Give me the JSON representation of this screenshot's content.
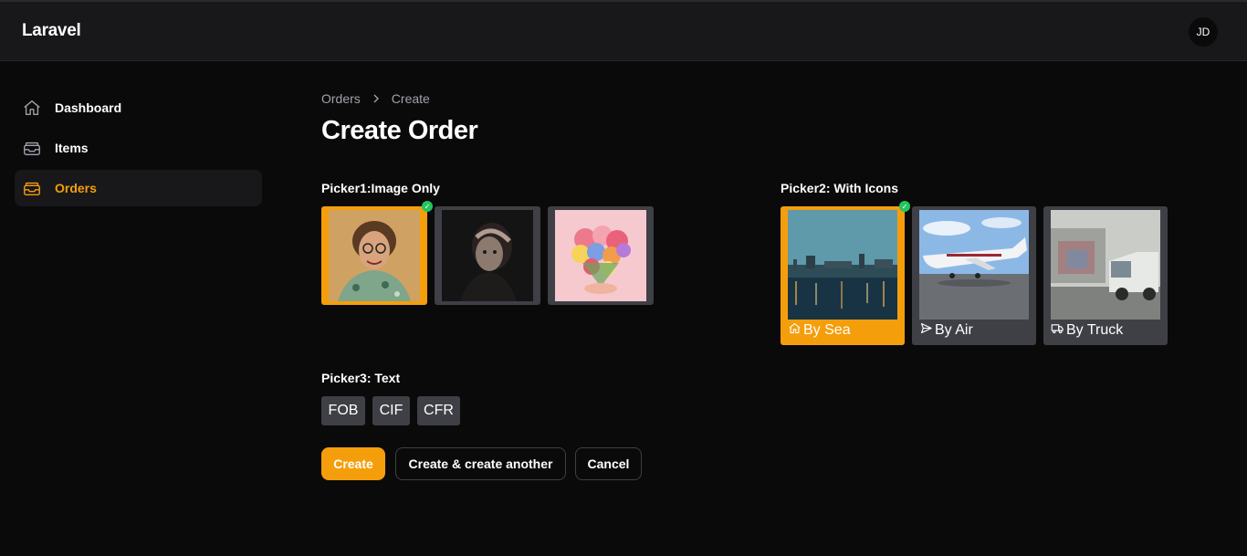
{
  "app": {
    "brand": "Laravel",
    "user_initials": "JD"
  },
  "sidebar": {
    "items": [
      {
        "label": "Dashboard",
        "icon": "home-icon",
        "active": false
      },
      {
        "label": "Items",
        "icon": "inbox-stack-icon",
        "active": false
      },
      {
        "label": "Orders",
        "icon": "inbox-stack-icon",
        "active": true
      }
    ]
  },
  "breadcrumb": {
    "items": [
      "Orders",
      "Create"
    ]
  },
  "page": {
    "title": "Create Order"
  },
  "picker1": {
    "label": "Picker1:Image Only",
    "selected_index": 0,
    "options": [
      {
        "image": "man-portrait-photo"
      },
      {
        "image": "woman-dark-portrait-photo"
      },
      {
        "image": "flower-heart-photo"
      }
    ]
  },
  "picker2": {
    "label": "Picker2: With Icons",
    "selected_index": 0,
    "options": [
      {
        "label": "By Sea",
        "icon": "home-icon",
        "image": "harbor-photo"
      },
      {
        "label": "By Air",
        "icon": "paper-plane-icon",
        "image": "jet-photo"
      },
      {
        "label": "By Truck",
        "icon": "truck-icon",
        "image": "truck-photo"
      }
    ]
  },
  "picker3": {
    "label": "Picker3: Text",
    "options": [
      "FOB",
      "CIF",
      "CFR"
    ]
  },
  "actions": {
    "create": "Create",
    "create_another": "Create & create another",
    "cancel": "Cancel"
  },
  "colors": {
    "accent": "#f59e0b",
    "surface": "#18181b",
    "tile": "#3f3f46",
    "check": "#22c55e"
  }
}
